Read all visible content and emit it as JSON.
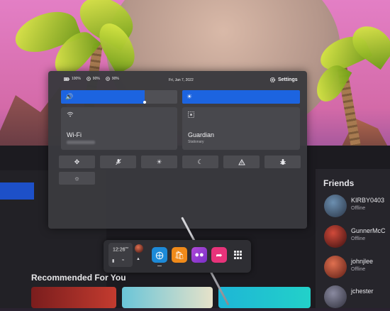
{
  "status_bar": {
    "headset_battery": "100%",
    "controller_left_battery": "90%",
    "controller_right_battery": "90%",
    "date": "Fri, Jan 7, 2022",
    "settings_label": "Settings"
  },
  "sliders": {
    "volume_level": 0.72,
    "brightness_level": 1.0
  },
  "tiles": {
    "wifi": {
      "label": "Wi-Fi"
    },
    "guardian": {
      "label": "Guardian",
      "sublabel": "Stationary"
    }
  },
  "toggles": [
    "move-icon",
    "mic-off-icon",
    "brightness-icon",
    "night-mode-icon",
    "triangle-icon",
    "bug-icon",
    "brightness-auto-icon"
  ],
  "dock": {
    "time": "12:26",
    "time_suffix": "PM",
    "apps": [
      "explore-icon",
      "store-icon",
      "people-icon",
      "share-icon"
    ]
  },
  "friends": {
    "title": "Friends",
    "list": [
      {
        "name": "KIRBY0403",
        "status": "Offline"
      },
      {
        "name": "GunnerMcC",
        "status": "Offline"
      },
      {
        "name": "johnjlee",
        "status": "Offline"
      },
      {
        "name": "jchester",
        "status": ""
      }
    ]
  },
  "home": {
    "recommended_title": "Recommended For You"
  },
  "colors": {
    "accent": "#1c64e0",
    "panel": "#3a3a3e",
    "tile": "#48484d"
  }
}
